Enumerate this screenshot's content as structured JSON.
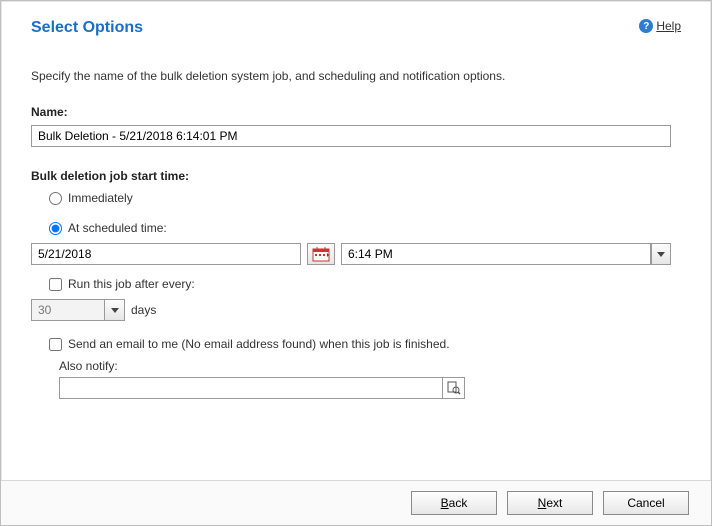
{
  "header": {
    "title": "Select Options",
    "help_label": "Help"
  },
  "subtitle": "Specify the name of the bulk deletion system job, and scheduling and notification options.",
  "name": {
    "label": "Name:",
    "value": "Bulk Deletion - 5/21/2018 6:14:01 PM"
  },
  "start_time": {
    "label": "Bulk deletion job start time:",
    "immediately_label": "Immediately",
    "scheduled_label": "At scheduled time:",
    "date_value": "5/21/2018",
    "time_value": "6:14 PM"
  },
  "recurrence": {
    "label": "Run this job after every:",
    "value": "30",
    "unit_label": "days"
  },
  "email": {
    "label": "Send an email to me (No email address found) when this job is finished.",
    "notify_label": "Also notify:",
    "notify_value": ""
  },
  "buttons": {
    "back": "Back",
    "next": "Next",
    "cancel": "Cancel"
  }
}
